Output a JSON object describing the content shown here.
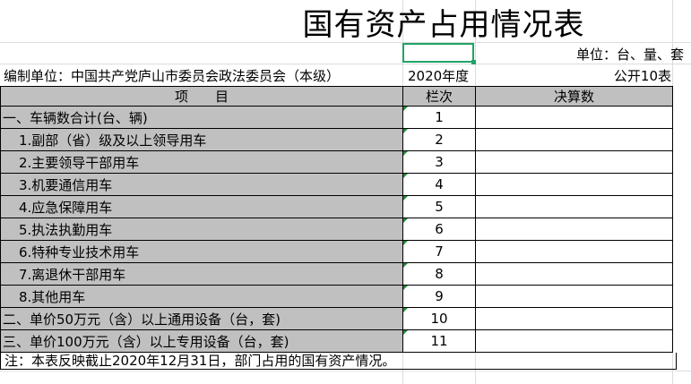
{
  "title": "国有资产占用情况表",
  "unit_label": "单位：台、量、套",
  "info": {
    "org": "编制单位：中国共产党庐山市委员会政法委员会（本级）",
    "year": "2020年度",
    "table_no": "公开10表"
  },
  "header": {
    "item": "项　　目",
    "seq": "栏次",
    "value": "决算数"
  },
  "rows": [
    {
      "item": "一、车辆数合计(台、辆)",
      "seq": "1",
      "value": ""
    },
    {
      "item": "1.副部（省）级及以上领导用车",
      "seq": "2",
      "value": ""
    },
    {
      "item": "2.主要领导干部用车",
      "seq": "3",
      "value": ""
    },
    {
      "item": "3.机要通信用车",
      "seq": "4",
      "value": ""
    },
    {
      "item": "4.应急保障用车",
      "seq": "5",
      "value": ""
    },
    {
      "item": "5.执法执勤用车",
      "seq": "6",
      "value": ""
    },
    {
      "item": "6.特种专业技术用车",
      "seq": "7",
      "value": ""
    },
    {
      "item": "7.离退休干部用车",
      "seq": "8",
      "value": ""
    },
    {
      "item": "8.其他用车",
      "seq": "9",
      "value": ""
    },
    {
      "item": "二、单价50万元（含）以上通用设备（台，套)",
      "seq": "10",
      "value": ""
    },
    {
      "item": "三、单价100万元（含）以上专用设备（台，套)",
      "seq": "11",
      "value": ""
    }
  ],
  "note": "注：本表反映截止2020年12月31日，部门占用的国有资产情况。",
  "colors": {
    "header_fill": "#c0c0c0",
    "selection": "#21a366",
    "gridline": "#dadcdf"
  }
}
